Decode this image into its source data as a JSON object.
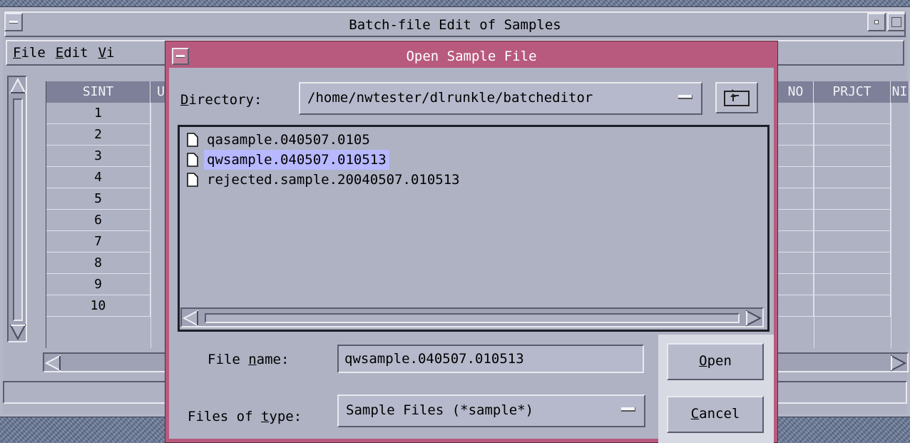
{
  "main_window": {
    "title": "Batch-file Edit of Samples",
    "menu": [
      {
        "mnemonic": "F",
        "rest": "ile"
      },
      {
        "mnemonic": "E",
        "rest": "dit"
      },
      {
        "mnemonic": "V",
        "rest": "i"
      }
    ],
    "columns": {
      "sint": "SINT",
      "u_partial": "U",
      "no_partial": "NO",
      "prjct": "PRJCT",
      "ni_partial": "NI"
    },
    "rows": [
      "1",
      "2",
      "3",
      "4",
      "5",
      "6",
      "7",
      "8",
      "9",
      "10"
    ]
  },
  "dialog": {
    "title": "Open Sample File",
    "directory": {
      "label_mnemonic": "D",
      "label_rest": "irectory:",
      "value": "/home/nwtester/dlrunkle/batcheditor"
    },
    "files": [
      {
        "name": "qasample.040507.0105",
        "selected": false
      },
      {
        "name": "qwsample.040507.010513",
        "selected": true
      },
      {
        "name": "rejected.sample.20040507.010513",
        "selected": false
      }
    ],
    "file_name": {
      "label_before": "File ",
      "label_mnemonic": "n",
      "label_after": "ame:",
      "value": "qwsample.040507.010513"
    },
    "file_type": {
      "label_before": "Files of ",
      "label_mnemonic": "t",
      "label_after": "ype:",
      "value": "Sample Files (*sample*)"
    },
    "open_button": {
      "mnemonic": "O",
      "rest": "pen"
    },
    "cancel_button": {
      "mnemonic": "C",
      "rest": "ancel"
    }
  },
  "colors": {
    "dialog_frame": "#b85a7d",
    "window_bg": "#aeb2c3",
    "header_bg": "#7d8098",
    "selection": "#b7b8ff"
  },
  "icons": [
    "window-menu-icon",
    "minimize-icon",
    "maximize-icon",
    "up-folder-icon",
    "document-icon",
    "scroll-arrow-icon",
    "dropdown-icon"
  ]
}
